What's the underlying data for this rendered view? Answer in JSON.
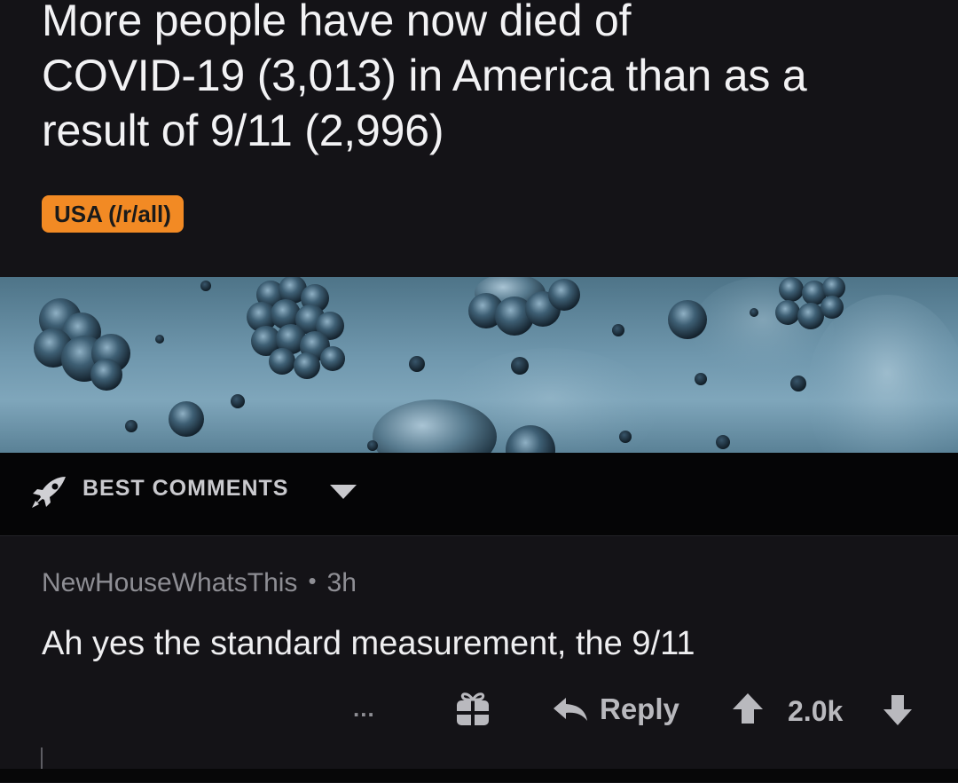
{
  "post": {
    "title": "More people have now died of\nCOVID-19 (3,013) in America than as a\nresult of 9/11 (2,996)",
    "flair": "USA (/r/all)",
    "flair_color": "#f28a24"
  },
  "sort": {
    "label": "BEST COMMENTS",
    "icon": "rocket-icon"
  },
  "comment": {
    "author": "NewHouseWhatsThis",
    "separator": "•",
    "age": "3h",
    "body": "Ah yes the standard measurement, the 9/11",
    "more": "...",
    "reply_label": "Reply",
    "score": "2.0k",
    "icons": {
      "gift": "gift-icon",
      "reply": "reply-arrow-icon",
      "upvote": "upvote-arrow-icon",
      "downvote": "downvote-arrow-icon"
    }
  },
  "colors": {
    "background": "#141317",
    "sort_bar": "#050506",
    "text_primary": "#eeeef0",
    "text_secondary": "#8e8e94"
  }
}
